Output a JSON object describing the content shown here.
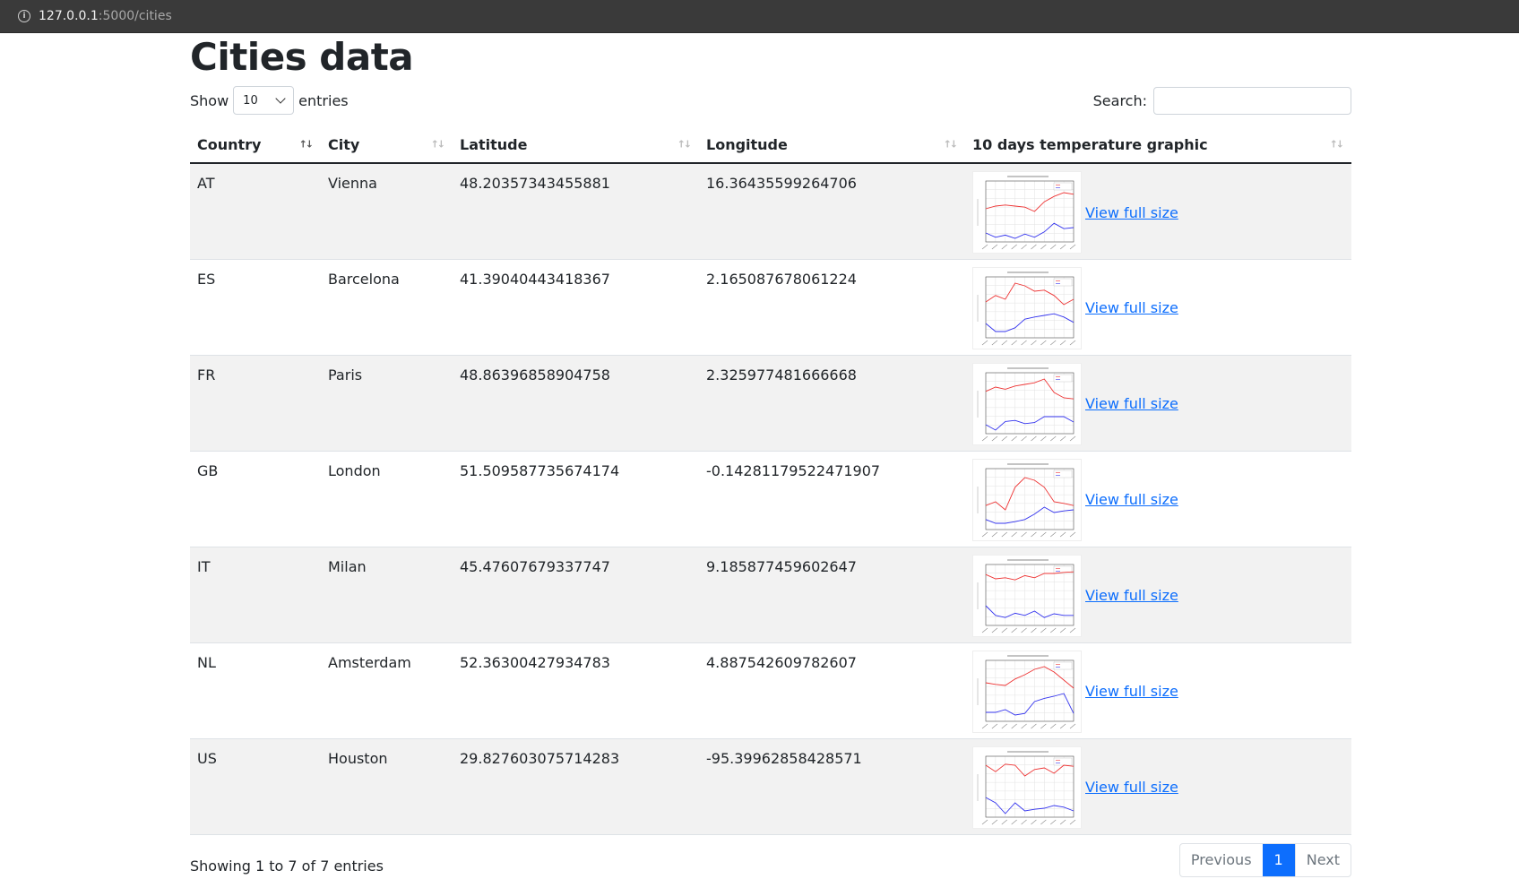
{
  "browser": {
    "url_host": "127.0.0.1",
    "url_path": ":5000/cities"
  },
  "page": {
    "title": "Cities data"
  },
  "controls": {
    "show_label": "Show",
    "entries_label": "entries",
    "page_length": "10",
    "search_label": "Search:",
    "search_value": ""
  },
  "table": {
    "headers": [
      "Country",
      "City",
      "Latitude",
      "Longitude",
      "10 days temperature graphic"
    ],
    "sort_icon": "↑↓",
    "link_label": "View full size",
    "rows": [
      {
        "country": "AT",
        "city": "Vienna",
        "lat": "48.20357343455881",
        "lon": "16.36435599264706"
      },
      {
        "country": "ES",
        "city": "Barcelona",
        "lat": "41.39040443418367",
        "lon": "2.165087678061224"
      },
      {
        "country": "FR",
        "city": "Paris",
        "lat": "48.86396858904758",
        "lon": "2.325977481666668"
      },
      {
        "country": "GB",
        "city": "London",
        "lat": "51.509587735674174",
        "lon": "-0.14281179522471907"
      },
      {
        "country": "IT",
        "city": "Milan",
        "lat": "45.47607679337747",
        "lon": "9.185877459602647"
      },
      {
        "country": "NL",
        "city": "Amsterdam",
        "lat": "52.36300427934783",
        "lon": "4.887542609782607"
      },
      {
        "country": "US",
        "city": "Houston",
        "lat": "29.827603075714283",
        "lon": "-95.39962858428571"
      }
    ]
  },
  "footer": {
    "info": "Showing 1 to 7 of 7 entries",
    "previous": "Previous",
    "current_page": "1",
    "next": "Next"
  },
  "thumbnails": [
    {
      "max": [
        0.55,
        0.6,
        0.62,
        0.6,
        0.58,
        0.5,
        0.68,
        0.78,
        0.85,
        0.82
      ],
      "min": [
        0.1,
        0.02,
        0.06,
        0.0,
        0.08,
        0.02,
        0.12,
        0.28,
        0.18,
        0.2
      ]
    },
    {
      "max": [
        0.6,
        0.72,
        0.65,
        0.95,
        0.9,
        0.8,
        0.82,
        0.72,
        0.55,
        0.65
      ],
      "min": [
        0.2,
        0.05,
        0.05,
        0.12,
        0.28,
        0.32,
        0.35,
        0.38,
        0.32,
        0.22
      ]
    },
    {
      "max": [
        0.72,
        0.8,
        0.76,
        0.82,
        0.85,
        0.88,
        0.95,
        0.7,
        0.6,
        0.58
      ],
      "min": [
        0.1,
        0.0,
        0.16,
        0.18,
        0.12,
        0.14,
        0.25,
        0.25,
        0.25,
        0.15
      ]
    },
    {
      "max": [
        0.38,
        0.45,
        0.3,
        0.72,
        0.9,
        0.85,
        0.72,
        0.45,
        0.42,
        0.38
      ],
      "min": [
        0.12,
        0.05,
        0.05,
        0.08,
        0.12,
        0.22,
        0.35,
        0.25,
        0.28,
        0.3
      ]
    },
    {
      "max": [
        0.88,
        0.8,
        0.82,
        0.78,
        0.86,
        0.82,
        0.9,
        0.9,
        0.92,
        0.93
      ],
      "min": [
        0.3,
        0.12,
        0.08,
        0.16,
        0.12,
        0.2,
        0.08,
        0.15,
        0.12,
        0.12
      ]
    },
    {
      "max": [
        0.65,
        0.62,
        0.6,
        0.72,
        0.8,
        0.9,
        0.95,
        0.85,
        0.7,
        0.55
      ],
      "min": [
        0.1,
        0.1,
        0.15,
        0.05,
        0.08,
        0.3,
        0.36,
        0.4,
        0.45,
        0.08
      ]
    },
    {
      "max": [
        0.9,
        0.78,
        0.92,
        0.9,
        0.7,
        0.82,
        0.85,
        0.75,
        0.9,
        0.88
      ],
      "min": [
        0.3,
        0.2,
        0.0,
        0.2,
        0.05,
        0.08,
        0.1,
        0.15,
        0.12,
        0.05
      ]
    }
  ]
}
